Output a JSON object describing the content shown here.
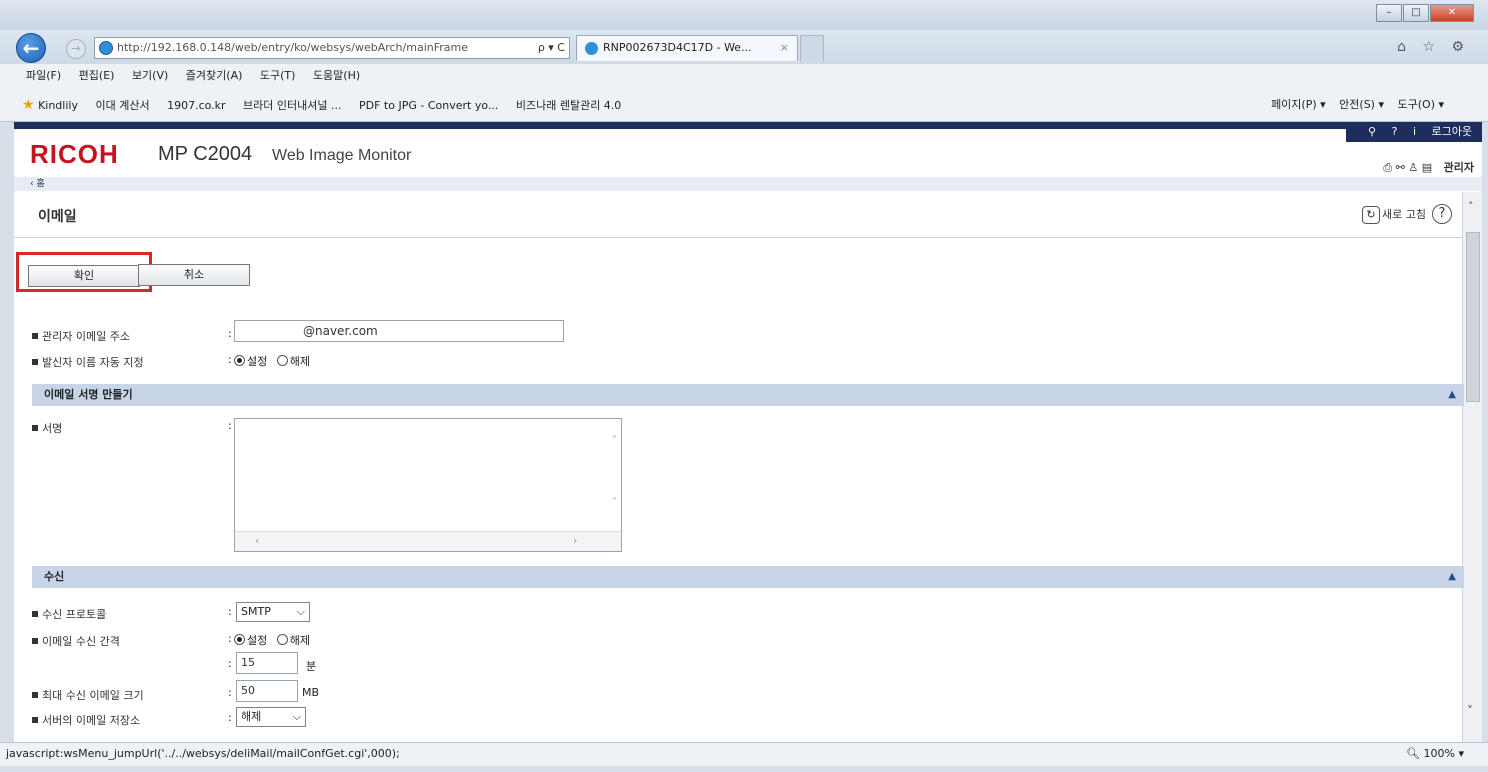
{
  "browser": {
    "address": "http://192.168.0.148/web/entry/ko/websys/webArch/mainFrame",
    "address_host": "192.168.0.148",
    "address_controls": "ρ ▾ C",
    "tab_title": "RNP002673D4C17D - We...",
    "tab_close": "×",
    "nav_icons": "⌂ ☆ ⚙",
    "menu": [
      "파일(F)",
      "편집(E)",
      "보기(V)",
      "즐겨찾기(A)",
      "도구(T)",
      "도움말(H)"
    ],
    "favorites": [
      "Kindlily",
      "이대 계산서",
      "1907.co.kr",
      "브라더 인터내셔널 ...",
      "PDF to JPG - Convert yo...",
      "비즈나래 렌탈관리 4.0"
    ],
    "command_bar": [
      "페이지(P) ▾",
      "안전(S) ▾",
      "도구(O) ▾"
    ],
    "status_text": "javascript:wsMenu_jumpUrl('../../websys/deliMail/mailConfGet.cgi',000);",
    "zoom": "100%"
  },
  "header": {
    "logo": "RICOH",
    "model": "MP C2004",
    "subtitle": "Web Image Monitor",
    "logout": "로그아웃",
    "admin": "관리자",
    "breadcrumb": "‹ 홈"
  },
  "page": {
    "title": "이메일",
    "refresh_label": "새로 고침",
    "help": "?"
  },
  "buttons": {
    "ok": "확인",
    "cancel": "취소"
  },
  "fields": {
    "admin_email_label": "관리자 이메일 주소",
    "admin_email_value": "@naver.com",
    "auto_sender_label": "발신자 이름 자동 지정",
    "set": "설정",
    "unset": "해제",
    "signature_section": "이메일 서명 만들기",
    "signature_label": "서명",
    "receive_section": "수신",
    "protocol_label": "수신 프로토콜",
    "protocol_value": "SMTP",
    "interval_label": "이메일 수신 간격",
    "interval_value": "15",
    "interval_unit": "분",
    "max_size_label": "최대 수신 이메일 크기",
    "max_size_value": "50",
    "max_size_unit": "MB",
    "server_storage_label": "서버의 이메일 저장소",
    "server_storage_value": "해제"
  }
}
